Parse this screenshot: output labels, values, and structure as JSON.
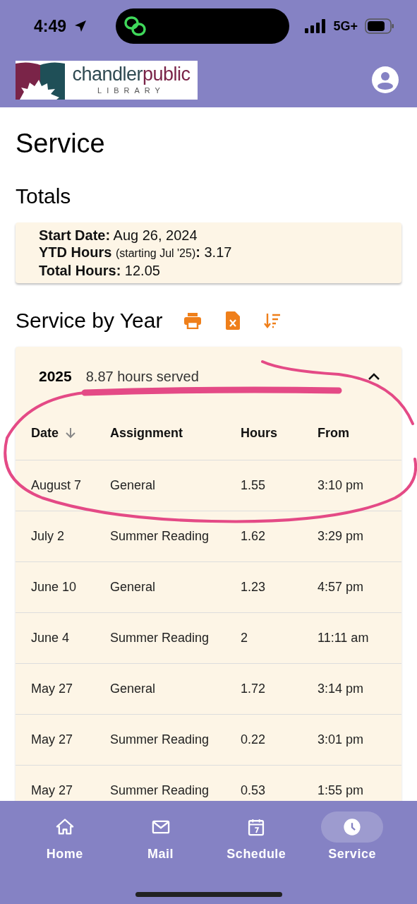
{
  "status_bar": {
    "time": "4:49",
    "network": "5G+"
  },
  "header": {
    "logo": {
      "name_main": "chandler",
      "name_accent": "public",
      "subtitle": "LIBRARY"
    }
  },
  "page_title": "Service",
  "totals": {
    "title": "Totals",
    "lines": [
      {
        "label": "Start Date:",
        "value": "Aug 26, 2024"
      },
      {
        "label": "YTD Hours",
        "note": "(starting Jul '25)",
        "label_end": ":",
        "value": "3.17"
      },
      {
        "label": "Total Hours:",
        "value": "12.05"
      }
    ]
  },
  "service_by_year": {
    "title": "Service by Year",
    "years": [
      {
        "year": "2025",
        "summary": "8.87 hours served",
        "expanded": true,
        "columns": [
          {
            "label": "Date",
            "sorted": true
          },
          {
            "label": "Assignment",
            "sorted": false
          },
          {
            "label": "Hours",
            "sorted": false
          },
          {
            "label": "From",
            "sorted": false
          }
        ],
        "rows": [
          [
            "August 7",
            "General",
            "1.55",
            "3:10 pm"
          ],
          [
            "July 2",
            "Summer Reading",
            "1.62",
            "3:29 pm"
          ],
          [
            "June 10",
            "General",
            "1.23",
            "4:57 pm"
          ],
          [
            "June 4",
            "Summer Reading",
            "2",
            "11:11 am"
          ],
          [
            "May 27",
            "General",
            "1.72",
            "3:14 pm"
          ],
          [
            "May 27",
            "Summer Reading",
            "0.22",
            "3:01 pm"
          ],
          [
            "May 27",
            "Summer Reading",
            "0.53",
            "1:55 pm"
          ]
        ]
      }
    ]
  },
  "bottom_nav": [
    {
      "label": "Home",
      "selected": false
    },
    {
      "label": "Mail",
      "selected": false
    },
    {
      "label": "Schedule",
      "selected": false
    },
    {
      "label": "Service",
      "selected": true
    }
  ]
}
